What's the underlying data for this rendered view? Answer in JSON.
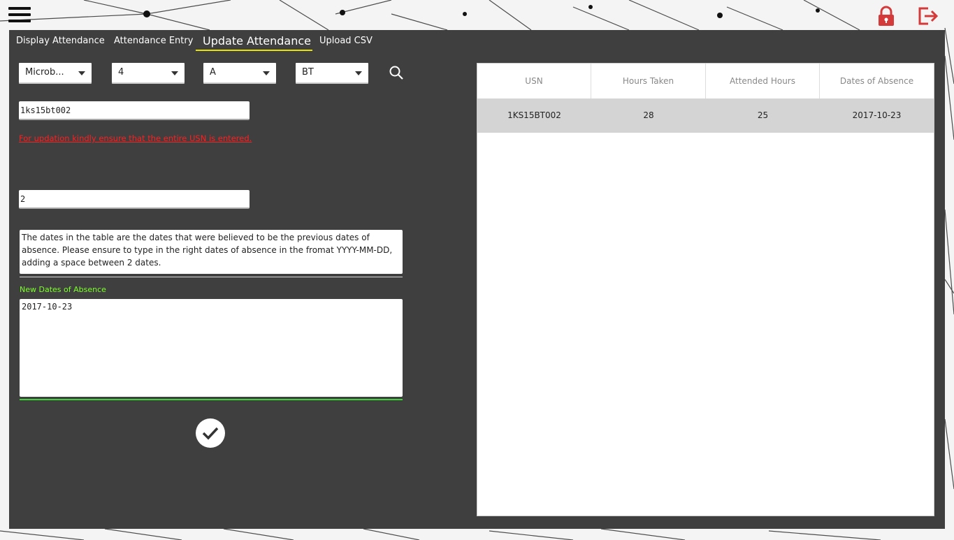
{
  "header": {
    "menu_icon": "hamburger-menu-icon",
    "lock_icon": "lock-icon",
    "logout_icon": "logout-icon",
    "accent_color": "#d43a3a"
  },
  "tabs": [
    {
      "label": "Display Attendance",
      "active": false
    },
    {
      "label": "Attendance Entry",
      "active": false
    },
    {
      "label": "Update Attendance",
      "active": true
    },
    {
      "label": "Upload CSV",
      "active": false
    }
  ],
  "filters": {
    "subject": "Microb...",
    "semester": "4",
    "section": "A",
    "department": "BT"
  },
  "form": {
    "usn_value": "1ks15bt002",
    "warning": "For updation kindly ensure that the entire USN is entered.",
    "attended_value": "2",
    "note": "The dates in the table are the dates that were believed to be the previous dates of absence. Please ensure to type in the right dates of absence in the fromat YYYY-MM-DD, adding a space between 2 dates.",
    "new_dates_label": "New Dates of Absence",
    "new_dates_value": "2017-10-23"
  },
  "table": {
    "headers": [
      "USN",
      "Hours Taken",
      "Attended Hours",
      "Dates of Absence"
    ],
    "rows": [
      [
        "1KS15BT002",
        "28",
        "25",
        "2017-10-23"
      ]
    ]
  }
}
